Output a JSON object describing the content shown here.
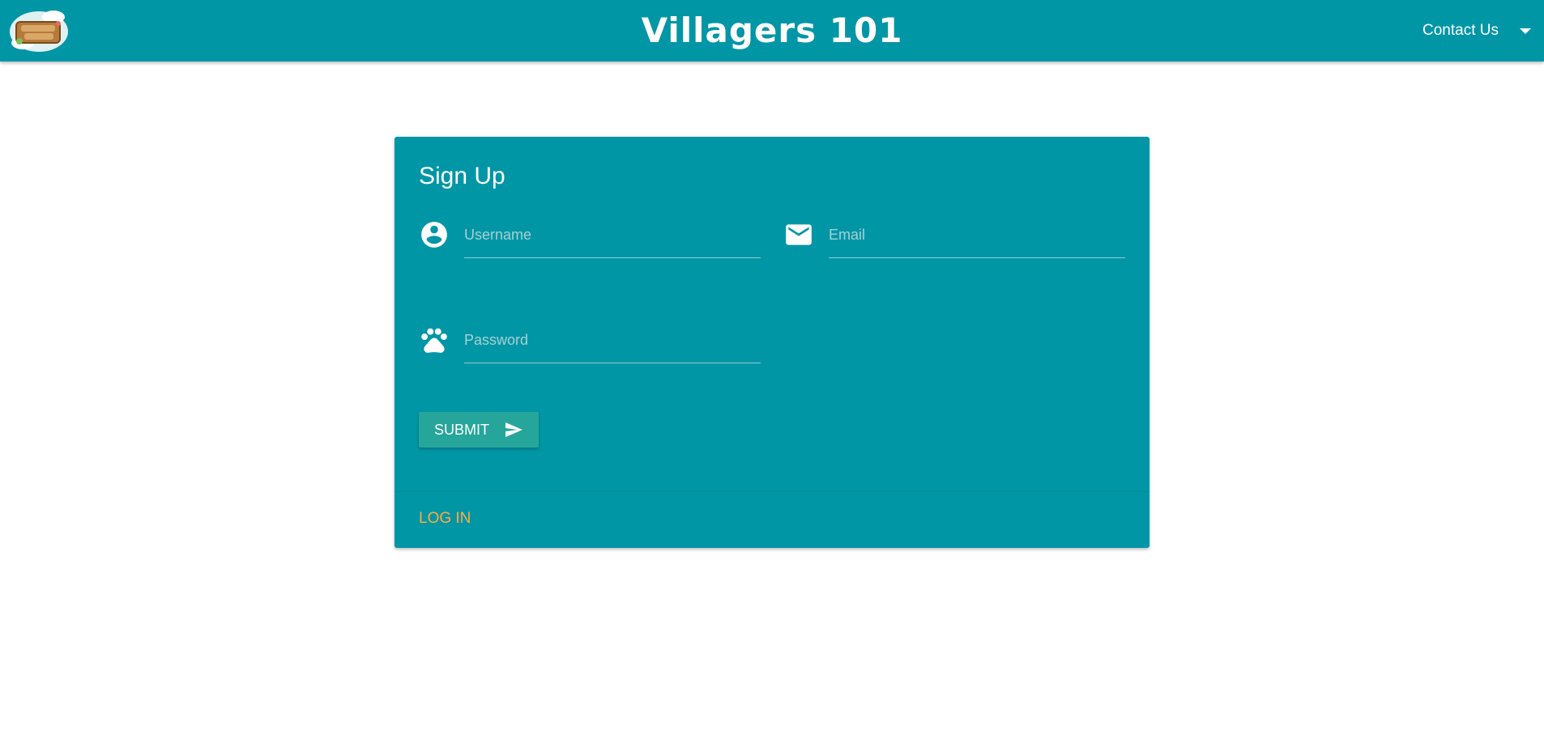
{
  "header": {
    "title": "Villagers 101",
    "contact_menu_label": "Contact Us",
    "logo_icon": "animal-crossing-logo-icon",
    "dropdown_icon": "caret-down-icon"
  },
  "signup_card": {
    "title": "Sign Up",
    "username": {
      "placeholder": "Username",
      "value": "",
      "icon": "account-circle-icon"
    },
    "email": {
      "placeholder": "Email",
      "value": "",
      "icon": "email-icon"
    },
    "password": {
      "placeholder": "Password",
      "value": "",
      "icon": "paw-icon"
    },
    "submit_label": "SUBMIT",
    "submit_icon": "send-icon",
    "login_link": "LOG IN"
  },
  "colors": {
    "primary": "#0096a6",
    "button": "#26a69a",
    "link": "#ffab40",
    "text": "#ffffff"
  }
}
